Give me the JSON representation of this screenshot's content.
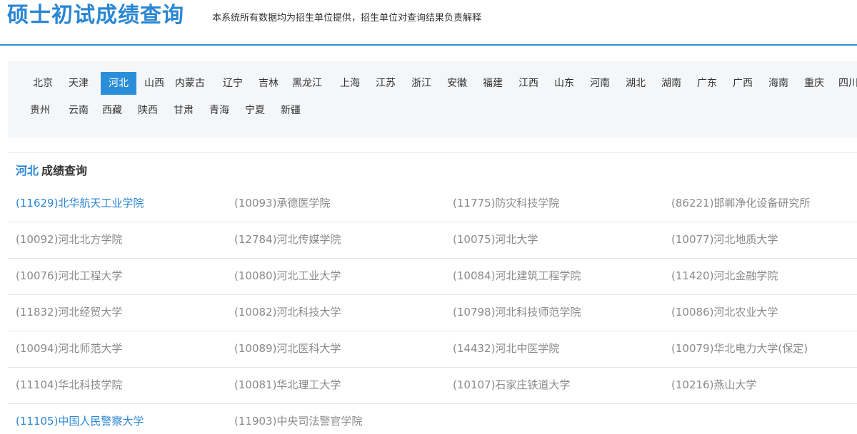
{
  "header": {
    "title": "硕士初试成绩查询",
    "description": "本系统所有数据均为招生单位提供，招生单位对查询结果负责解释"
  },
  "provinces": {
    "row1": [
      "北京",
      "天津",
      "河北",
      "山西",
      "内蒙古",
      "辽宁",
      "吉林",
      "黑龙江",
      "上海",
      "江苏",
      "浙江",
      "安徽",
      "福建",
      "江西",
      "山东",
      "河南",
      "湖北",
      "湖南",
      "广东",
      "广西",
      "海南",
      "重庆",
      "四川"
    ],
    "row2": [
      "贵州",
      "云南",
      "西藏",
      "陕西",
      "甘肃",
      "青海",
      "宁夏",
      "新疆"
    ],
    "active": "河北"
  },
  "results": {
    "province": "河北",
    "title_suffix": "成绩查询",
    "rows": [
      [
        "(11629)北华航天工业学院",
        "(10093)承德医学院",
        "(11775)防灾科技学院",
        "(86221)邯郸净化设备研究所"
      ],
      [
        "(10092)河北北方学院",
        "(12784)河北传媒学院",
        "(10075)河北大学",
        "(10077)河北地质大学"
      ],
      [
        "(10076)河北工程大学",
        "(10080)河北工业大学",
        "(10084)河北建筑工程学院",
        "(11420)河北金融学院"
      ],
      [
        "(11832)河北经贸大学",
        "(10082)河北科技大学",
        "(10798)河北科技师范学院",
        "(10086)河北农业大学"
      ],
      [
        "(10094)河北师范大学",
        "(10089)河北医科大学",
        "(14432)河北中医学院",
        "(10079)华北电力大学(保定)"
      ],
      [
        "(11104)华北科技学院",
        "(10081)华北理工大学",
        "(10107)石家庄铁道大学",
        "(10216)燕山大学"
      ],
      [
        "(11105)中国人民警察大学",
        "(11903)中央司法警官学院"
      ]
    ],
    "highlighted": [
      "(11629)北华航天工业学院",
      "(11105)中国人民警察大学"
    ]
  },
  "colors": {
    "accent": "#2a86d3",
    "active_tab_bg": "#2a8fd8",
    "link_gray": "#8a8a8a",
    "panel_bg": "#f4f6f8"
  }
}
